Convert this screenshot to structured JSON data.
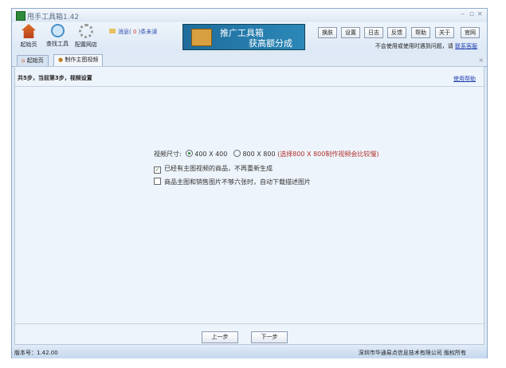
{
  "window": {
    "title": "甩手工具箱1.42"
  },
  "toolbar": {
    "tools": [
      {
        "label": "起始页"
      },
      {
        "label": "查找工具"
      },
      {
        "label": "配置网店"
      }
    ],
    "message_prefix": "消息(",
    "message_count": "0",
    "message_suffix": ")条未读",
    "banner_line1": "推广工具箱",
    "banner_line2": "获高额分成",
    "buttons": [
      "换肤",
      "设置",
      "日志",
      "反馈",
      "帮助",
      "关于",
      "官网"
    ],
    "hint": "不会使用或使用时遇到问题，请",
    "hint_link": "联系客服"
  },
  "tabs": [
    {
      "label": "起始页"
    },
    {
      "label": "制作主图视频"
    }
  ],
  "content": {
    "step": "共5步，当前第3步，视频设置",
    "help": "使用帮助",
    "size_label": "视频尺寸:",
    "size_options": [
      "400 X 400",
      "800 X 800"
    ],
    "size_warning": "(选择800 X 800制作视频会比较慢)",
    "checkbox1": "已经有主图视频的商品，不再重新生成",
    "checkbox2": "商品主图和销售图片不够六张时，自动下载描述图片",
    "prev": "上一步",
    "next": "下一步"
  },
  "status": {
    "version": "版本号：1.42.00",
    "copyright": "深圳市华通易点信息技术有限公司 版权所有"
  }
}
